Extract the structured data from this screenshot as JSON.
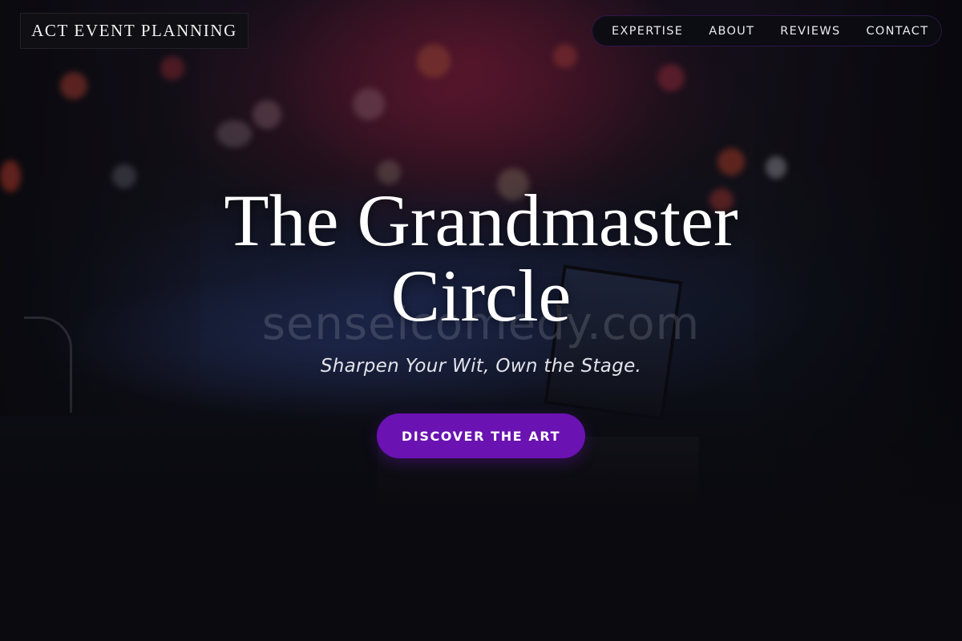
{
  "header": {
    "brand": "ACT EVENT PLANNING",
    "nav": [
      {
        "label": "EXPERTISE"
      },
      {
        "label": "ABOUT"
      },
      {
        "label": "REVIEWS"
      },
      {
        "label": "CONTACT"
      }
    ]
  },
  "hero": {
    "title_line1": "The Grandmaster",
    "title_line2": "Circle",
    "subtitle": "Sharpen Your Wit, Own the Stage.",
    "cta_label": "DISCOVER THE ART",
    "watermark": "senseicomedy.com"
  },
  "colors": {
    "accent": "#6a12b2",
    "background": "#0c0c10",
    "text": "#ffffff"
  }
}
